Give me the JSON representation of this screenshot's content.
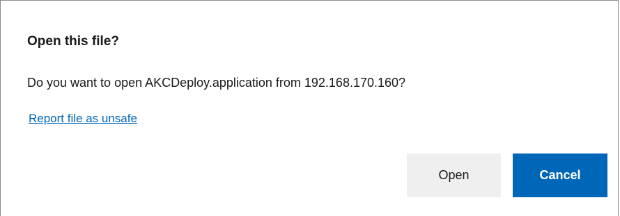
{
  "dialog": {
    "title": "Open this file?",
    "message": "Do you want to open AKCDeploy.application from 192.168.170.160?",
    "report_link": "Report file as unsafe",
    "open_label": "Open",
    "cancel_label": "Cancel"
  },
  "colors": {
    "link": "#0067b8",
    "primary_button": "#0067b8",
    "secondary_button": "#efefef"
  }
}
